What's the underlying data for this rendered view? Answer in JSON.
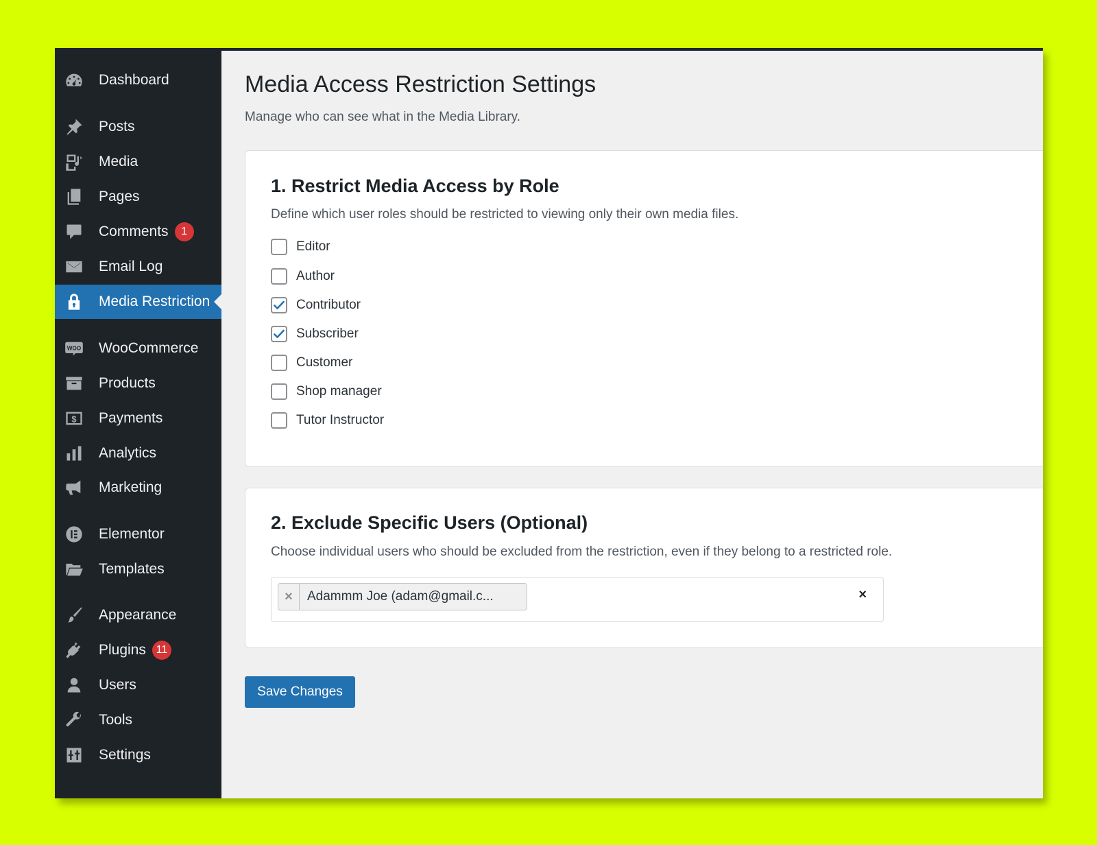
{
  "sidebar": {
    "items": [
      {
        "label": "Dashboard",
        "icon": "dashboard-icon"
      },
      {
        "label": "Posts",
        "icon": "pushpin-icon"
      },
      {
        "label": "Media",
        "icon": "media-icon"
      },
      {
        "label": "Pages",
        "icon": "pages-icon"
      },
      {
        "label": "Comments",
        "icon": "comment-icon",
        "badge": "1"
      },
      {
        "label": "Email Log",
        "icon": "email-icon"
      },
      {
        "label": "Media Restriction",
        "icon": "lock-icon",
        "active": true
      },
      {
        "label": "WooCommerce",
        "icon": "woocommerce-icon"
      },
      {
        "label": "Products",
        "icon": "archive-box-icon"
      },
      {
        "label": "Payments",
        "icon": "dollar-icon"
      },
      {
        "label": "Analytics",
        "icon": "bar-chart-icon"
      },
      {
        "label": "Marketing",
        "icon": "megaphone-icon"
      },
      {
        "label": "Elementor",
        "icon": "elementor-icon"
      },
      {
        "label": "Templates",
        "icon": "folder-icon"
      },
      {
        "label": "Appearance",
        "icon": "paintbrush-icon"
      },
      {
        "label": "Plugins",
        "icon": "plug-icon",
        "badge": "11"
      },
      {
        "label": "Users",
        "icon": "user-icon"
      },
      {
        "label": "Tools",
        "icon": "wrench-icon"
      },
      {
        "label": "Settings",
        "icon": "sliders-icon"
      }
    ]
  },
  "page": {
    "title": "Media Access Restriction Settings",
    "description": "Manage who can see what in the Media Library."
  },
  "section1": {
    "heading": "1. Restrict Media Access by Role",
    "description": "Define which user roles should be restricted to viewing only their own media files.",
    "roles": [
      {
        "label": "Editor",
        "checked": false
      },
      {
        "label": "Author",
        "checked": false
      },
      {
        "label": "Contributor",
        "checked": true
      },
      {
        "label": "Subscriber",
        "checked": true
      },
      {
        "label": "Customer",
        "checked": false
      },
      {
        "label": "Shop manager",
        "checked": false
      },
      {
        "label": "Tutor Instructor",
        "checked": false
      }
    ]
  },
  "section2": {
    "heading": "2. Exclude Specific Users (Optional)",
    "description": "Choose individual users who should be excluded from the restriction, even if they belong to a restricted role.",
    "selected_user": "Adammm Joe (adam@gmail.c...",
    "chip_remove": "×",
    "clear_all": "×"
  },
  "actions": {
    "save_label": "Save Changes"
  },
  "colors": {
    "background": "#d7ff00",
    "sidebar": "#1d2327",
    "accent": "#2271b1",
    "badge": "#d63638"
  }
}
